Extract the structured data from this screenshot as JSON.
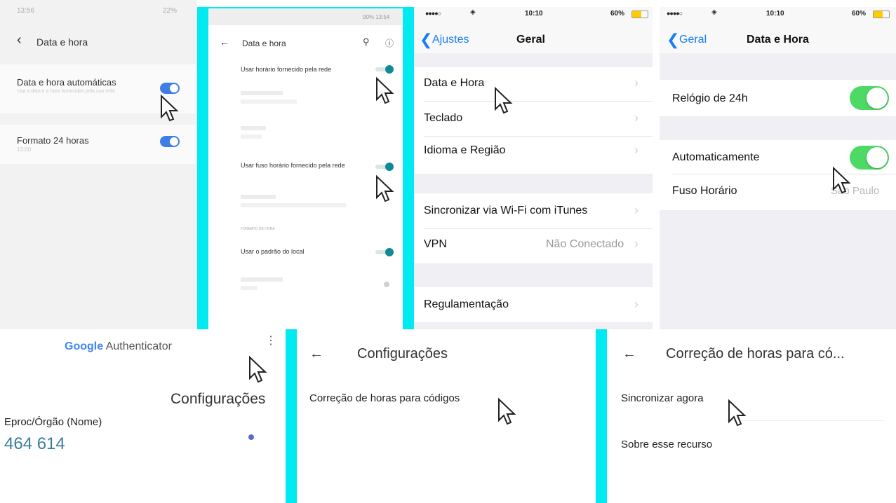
{
  "colors": {
    "divider": "#00eaf2",
    "android_blue": "#3e7ee6",
    "teal": "#0f8a94",
    "ios_green": "#4cd964",
    "ios_blue": "#1a7cf6"
  },
  "panel1": {
    "status_time": "13:56",
    "status_right": "22%",
    "title": "Data e hora",
    "auto_label": "Data e hora automáticas",
    "auto_sub": "Usa a data e a hora fornecidas pela sua rede",
    "format_label": "Formato 24 horas",
    "format_sub": "13:00"
  },
  "panel2": {
    "status": "90% 13:54",
    "title": "Data e hora",
    "items": [
      "Usar horário fornecido pela rede",
      "Usar fuso horário fornecido pela rede",
      "Usar o padrão do local"
    ],
    "section_label": "FORMATO DE HORA"
  },
  "panel3": {
    "status_time": "10:10",
    "status_battery": "60%",
    "back_label": "Ajustes",
    "title": "Geral",
    "rows": [
      "Data e Hora",
      "Teclado",
      "Idioma e Região"
    ],
    "sync_label": "Sincronizar via Wi-Fi com iTunes",
    "vpn_label": "VPN",
    "vpn_value": "Não Conectado",
    "reg_label": "Regulamentação"
  },
  "panel4": {
    "status_time": "10:10",
    "status_battery": "60%",
    "back_label": "Geral",
    "title": "Data e Hora",
    "clock_label": "Relógio de 24h",
    "auto_label": "Automaticamente",
    "tz_label": "Fuso Horário",
    "tz_value": "São Paulo"
  },
  "panel5": {
    "app_title_brand": "Google",
    "app_title_rest": " Authenticator",
    "menu_popup": "Configurações",
    "account_name": "Eproc/Órgão (Nome)",
    "code": "464 614"
  },
  "panel6": {
    "title": "Configurações",
    "item": "Correção de horas para códigos"
  },
  "panel7": {
    "title": "Correção de horas para có...",
    "item1": "Sincronizar agora",
    "item2": "Sobre esse recurso"
  }
}
